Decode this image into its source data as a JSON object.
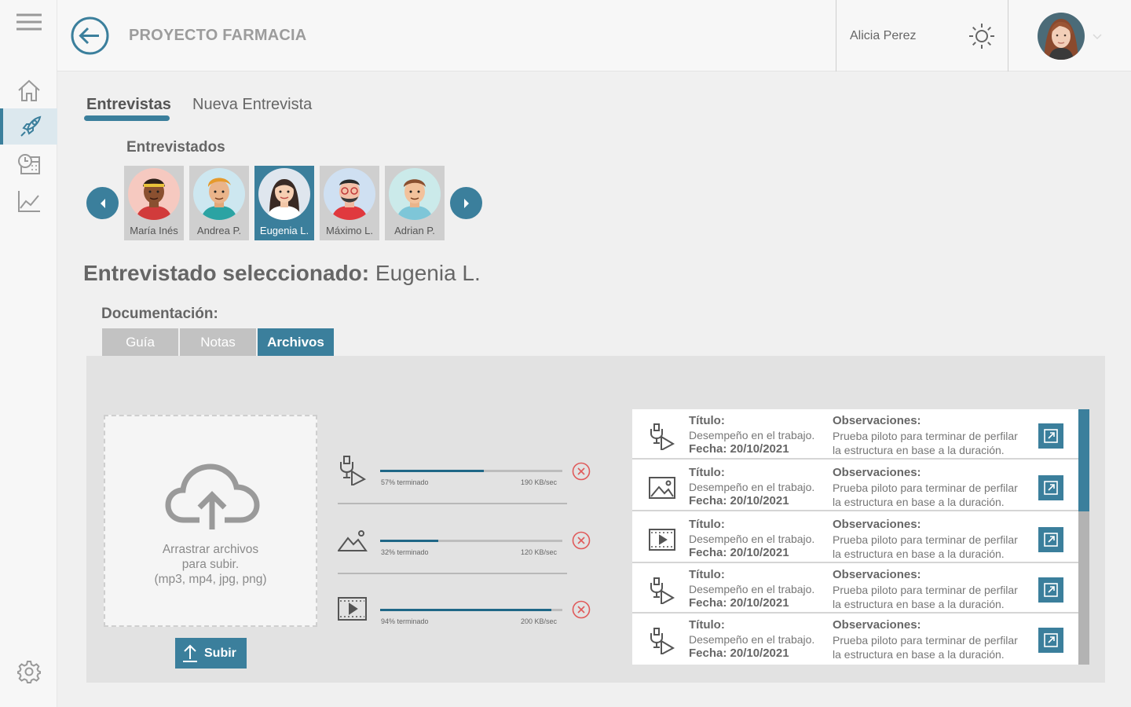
{
  "app": {
    "title": "PROYECTO FARMACIA"
  },
  "user": {
    "name": "Alicia Perez"
  },
  "sidebar": {
    "items": [
      {
        "icon": "menu-icon"
      },
      {
        "icon": "home-icon"
      },
      {
        "icon": "rocket-icon",
        "active": true
      },
      {
        "icon": "calendar-clock-icon"
      },
      {
        "icon": "chart-line-icon"
      },
      {
        "icon": "settings-icon"
      }
    ]
  },
  "tabs": [
    {
      "label": "Entrevistas",
      "active": true
    },
    {
      "label": "Nueva Entrevista"
    }
  ],
  "interviewees": {
    "heading": "Entrevistados",
    "people": [
      {
        "name": "María Inés"
      },
      {
        "name": "Andrea P."
      },
      {
        "name": "Eugenia L.",
        "selected": true
      },
      {
        "name": "Máximo L."
      },
      {
        "name": "Adrian P."
      }
    ]
  },
  "selected": {
    "label": "Entrevistado seleccionado:",
    "name": "Eugenia L."
  },
  "documentation": {
    "heading": "Documentación:",
    "tabs": [
      {
        "label": "Guía"
      },
      {
        "label": "Notas"
      },
      {
        "label": "Archivos",
        "active": true
      }
    ]
  },
  "upload": {
    "drop_line1": "Arrastrar archivos",
    "drop_line2": "para subir.",
    "drop_line3": "(mp3, mp4, jpg, png)",
    "button_label": "Subir"
  },
  "uploads": [
    {
      "icon": "audio-file-icon",
      "progress": 0.57,
      "status": "57% terminado",
      "speed": "190 KB/sec"
    },
    {
      "icon": "image-file-icon",
      "progress": 0.32,
      "status": "32% terminado",
      "speed": "120 KB/sec"
    },
    {
      "icon": "video-file-icon",
      "progress": 0.94,
      "status": "94% terminado",
      "speed": "200 KB/sec"
    }
  ],
  "files": [
    {
      "icon": "audio-file-icon",
      "title_label": "Título:",
      "title": "Desempeño en el trabajo.",
      "date": "Fecha: 20/10/2021",
      "obs_label": "Observaciones:",
      "obs": "Prueba piloto para terminar de perfilar la estructura en base a la duración."
    },
    {
      "icon": "image-file-icon",
      "title_label": "Título:",
      "title": "Desempeño en el trabajo.",
      "date": "Fecha: 20/10/2021",
      "obs_label": "Observaciones:",
      "obs": "Prueba piloto para terminar de perfilar la estructura en base a la duración."
    },
    {
      "icon": "video-file-icon",
      "title_label": "Título:",
      "title": "Desempeño en el trabajo.",
      "date": "Fecha: 20/10/2021",
      "obs_label": "Observaciones:",
      "obs": "Prueba piloto para terminar de perfilar la estructura en base a la duración."
    },
    {
      "icon": "audio-file-icon",
      "title_label": "Título:",
      "title": "Desempeño en el trabajo.",
      "date": "Fecha: 20/10/2021",
      "obs_label": "Observaciones:",
      "obs": "Prueba piloto para terminar de perfilar la estructura en base a la duración."
    },
    {
      "icon": "audio-file-icon",
      "title_label": "Título:",
      "title": "Desempeño en el trabajo.",
      "date": "Fecha: 20/10/2021",
      "obs_label": "Observaciones:",
      "obs": "Prueba piloto para terminar de perfilar la estructura en base a la duración."
    }
  ],
  "colors": {
    "accent": "#3b7f9c",
    "progress": "#1f6787",
    "cancel": "#e05a5a"
  }
}
